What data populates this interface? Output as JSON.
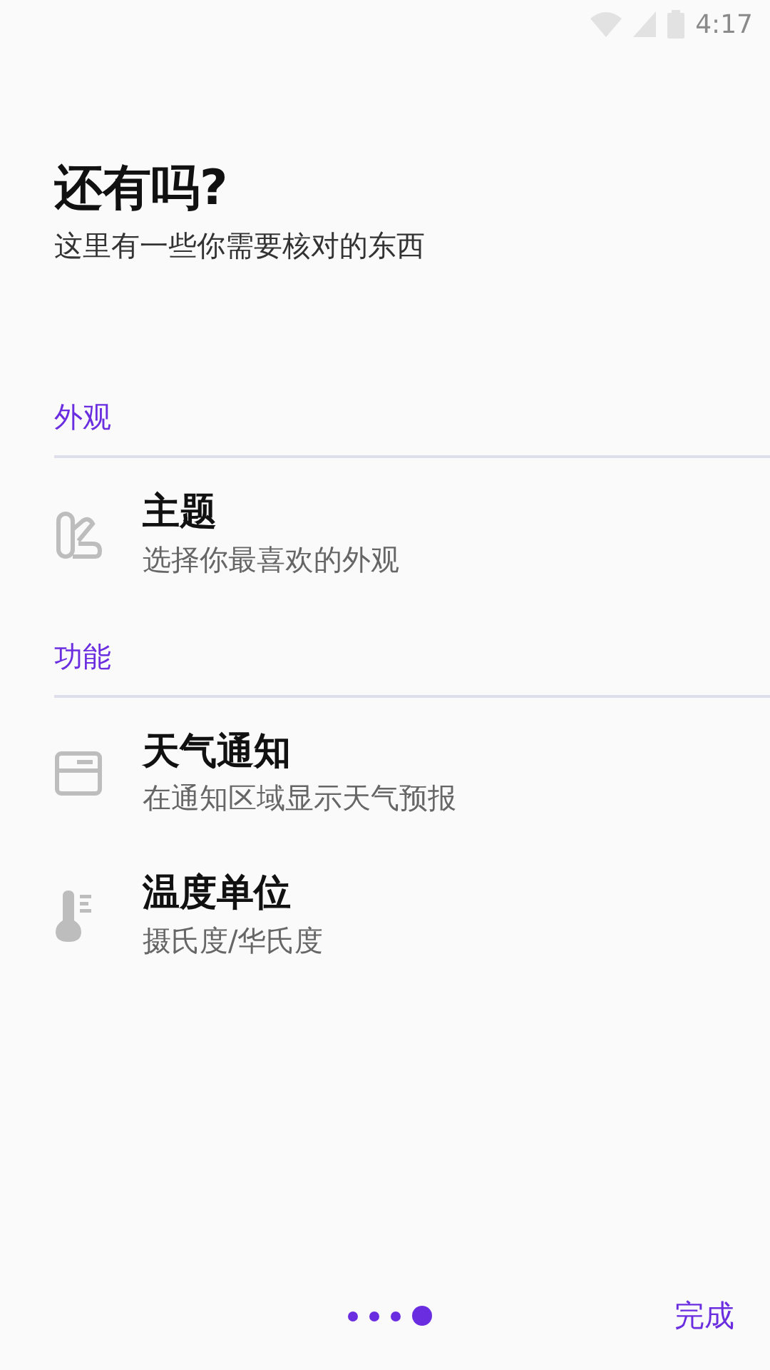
{
  "status_bar": {
    "time": "4:17"
  },
  "title": "还有吗?",
  "subtitle": "这里有一些你需要核对的东西",
  "sections": [
    {
      "header": "外观",
      "items": [
        {
          "kind": "theme",
          "title": "主题",
          "subtitle": "选择你最喜欢的外观"
        }
      ]
    },
    {
      "header": "功能",
      "items": [
        {
          "kind": "notification",
          "title": "天气通知",
          "subtitle": "在通知区域显示天气预报"
        },
        {
          "kind": "temperature",
          "title": "温度单位",
          "subtitle": "摄氏度/华氏度"
        }
      ]
    }
  ],
  "pager": [
    {
      "selected": false
    },
    {
      "selected": false
    },
    {
      "selected": false
    },
    {
      "selected": true
    }
  ],
  "done_button": "完成"
}
